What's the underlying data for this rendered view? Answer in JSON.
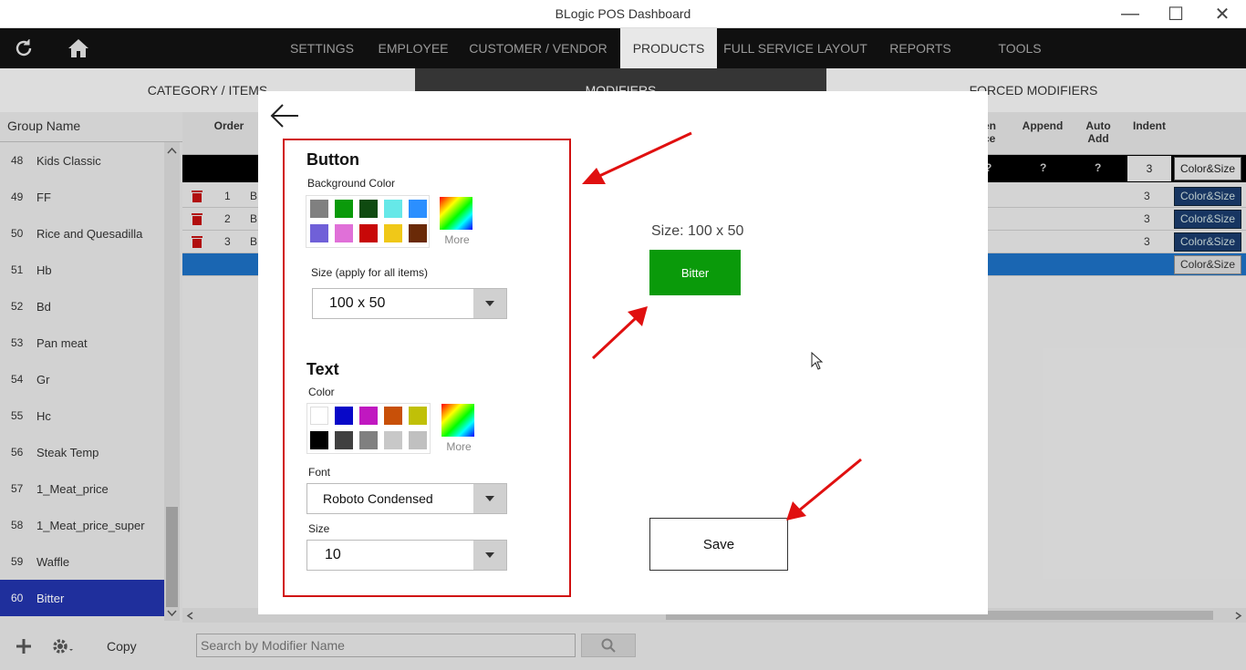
{
  "window": {
    "title": "BLogic POS Dashboard",
    "minimize": "—",
    "maximize": "☐",
    "close": "✕"
  },
  "menu": {
    "items": [
      "SETTINGS",
      "EMPLOYEE",
      "CUSTOMER / VENDOR",
      "PRODUCTS",
      "FULL SERVICE LAYOUT",
      "REPORTS",
      "TOOLS"
    ],
    "active": "PRODUCTS"
  },
  "subtabs": [
    "CATEGORY / ITEMS",
    "MODIFIERS",
    "FORCED MODIFIERS"
  ],
  "left_panel": {
    "header": "Group Name",
    "rows": [
      {
        "num": "48",
        "name": "Kids Classic"
      },
      {
        "num": "49",
        "name": "FF"
      },
      {
        "num": "50",
        "name": "Rice and Quesadilla"
      },
      {
        "num": "51",
        "name": "Hb"
      },
      {
        "num": "52",
        "name": "Bd"
      },
      {
        "num": "53",
        "name": "Pan meat"
      },
      {
        "num": "54",
        "name": "Gr"
      },
      {
        "num": "55",
        "name": "Hc"
      },
      {
        "num": "56",
        "name": "Steak Temp"
      },
      {
        "num": "57",
        "name": "1_Meat_price"
      },
      {
        "num": "58",
        "name": "1_Meat_price_super"
      },
      {
        "num": "59",
        "name": "Waffle"
      },
      {
        "num": "60",
        "name": "Bitter"
      }
    ],
    "selected": "60",
    "bottom": {
      "copy_label": "Copy"
    }
  },
  "grid": {
    "headers": {
      "order": "Order",
      "hidden_price": "en\nce",
      "append": "Append",
      "auto_add": "Auto\nAdd",
      "indent": "Indent"
    },
    "black_row": {
      "q1": "?",
      "q2": "?",
      "q3": "?",
      "indent": "3",
      "button": "Color&Size"
    },
    "rows": [
      {
        "order": "1",
        "name": "B",
        "indent": "3",
        "button": "Color&Size"
      },
      {
        "order": "2",
        "name": "B",
        "indent": "3",
        "button": "Color&Size"
      },
      {
        "order": "3",
        "name": "B",
        "indent": "3",
        "button": "Color&Size"
      }
    ],
    "new_row_button": "Color&Size",
    "search_placeholder": "Search by Modifier Name"
  },
  "modal": {
    "button_section": {
      "title": "Button",
      "bg_label": "Background Color",
      "bg_colors": [
        "#808080",
        "#0a9a0a",
        "#0f4a10",
        "#66e8e8",
        "#2b8fff",
        "#7060d8",
        "#e070d8",
        "#c80808",
        "#f0c818",
        "#6a2a08"
      ],
      "more_label": "More",
      "size_label": "Size (apply for all items)",
      "size_value": "100 x 50"
    },
    "text_section": {
      "title": "Text",
      "color_label": "Color",
      "colors": [
        "#ffffff",
        "#0808c8",
        "#c018c0",
        "#c85008",
        "#c0c008",
        "#000000",
        "#404040",
        "#808080",
        "#c8c8c8",
        "#c0c0c0"
      ],
      "more_label": "More",
      "font_label": "Font",
      "font_value": "Roboto Condensed",
      "size_label": "Size",
      "size_value": "10"
    },
    "preview": {
      "size_text": "Size: 100 x 50",
      "button_text": "Bitter",
      "button_color": "#0a9a0a"
    },
    "save_label": "Save"
  },
  "colors": {
    "accent_red": "#d01010",
    "menubar": "#101010",
    "selected_blue": "#2233aa"
  }
}
